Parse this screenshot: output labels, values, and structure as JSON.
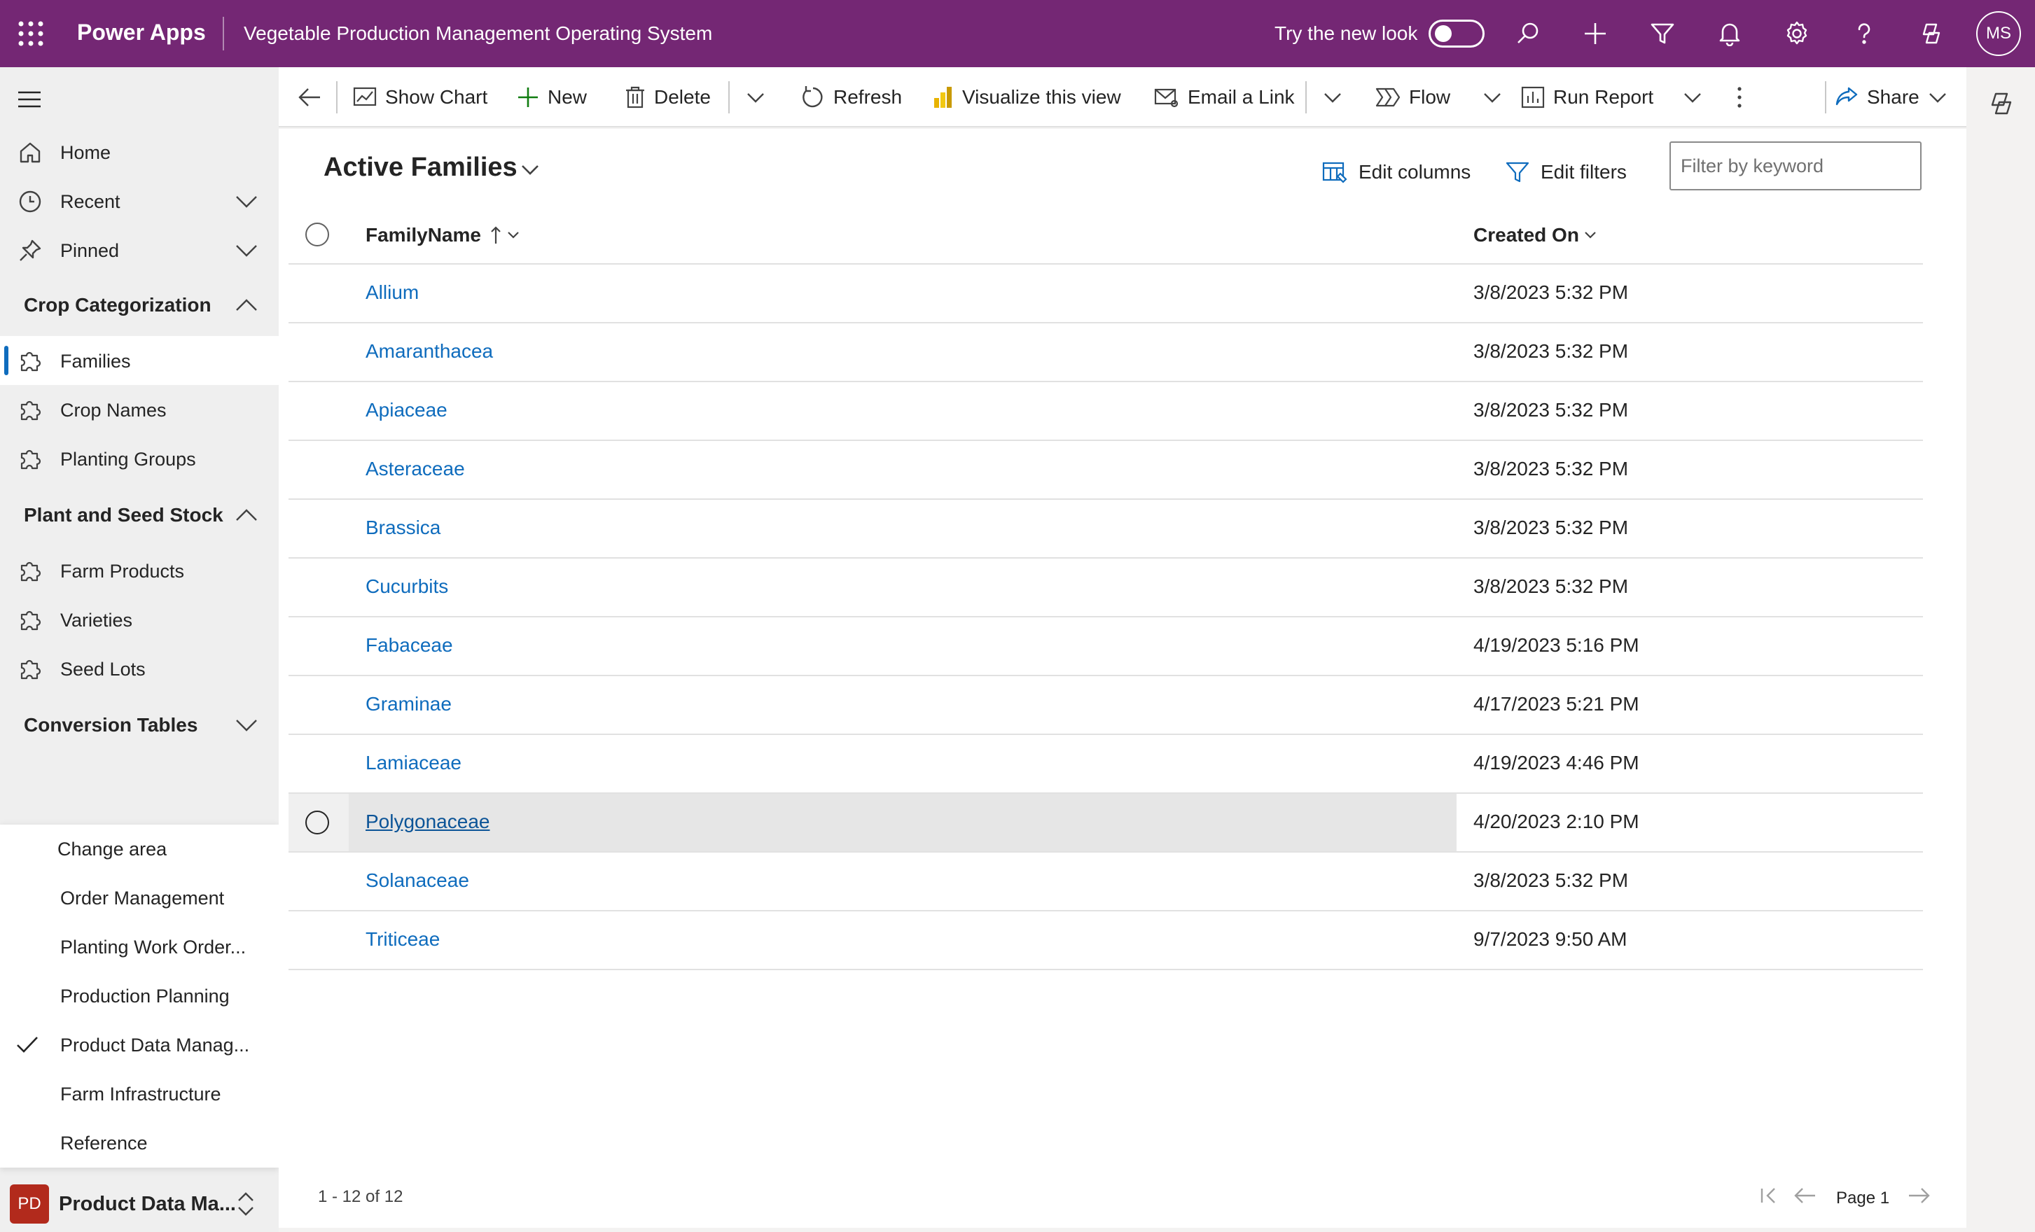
{
  "topbar": {
    "brand": "Power Apps",
    "app_title": "Vegetable Production Management Operating System",
    "try_new_look": "Try the new look",
    "avatar_initials": "MS"
  },
  "nav": {
    "home": "Home",
    "recent": "Recent",
    "pinned": "Pinned",
    "group_crop": "Crop Categorization",
    "families": "Families",
    "crop_names": "Crop Names",
    "planting_groups": "Planting Groups",
    "group_stock": "Plant and Seed Stock",
    "farm_products": "Farm Products",
    "varieties": "Varieties",
    "seed_lots": "Seed Lots",
    "group_conversion": "Conversion Tables"
  },
  "change_area": {
    "heading": "Change area",
    "items": [
      "Order Management",
      "Planting Work Order...",
      "Production Planning",
      "Product Data Manag...",
      "Farm Infrastructure",
      "Reference"
    ],
    "current_badge": "PD",
    "current_label": "Product Data Ma..."
  },
  "commands": {
    "show_chart": "Show Chart",
    "new": "New",
    "delete": "Delete",
    "refresh": "Refresh",
    "visualize": "Visualize this view",
    "email_link": "Email a Link",
    "flow": "Flow",
    "run_report": "Run Report",
    "share": "Share"
  },
  "view": {
    "title": "Active Families",
    "edit_columns": "Edit columns",
    "edit_filters": "Edit filters",
    "filter_placeholder": "Filter by keyword"
  },
  "grid": {
    "col_name": "FamilyName",
    "col_created": "Created On",
    "rows": [
      {
        "name": "Allium",
        "created": "3/8/2023 5:32 PM"
      },
      {
        "name": "Amaranthacea",
        "created": "3/8/2023 5:32 PM"
      },
      {
        "name": "Apiaceae",
        "created": "3/8/2023 5:32 PM"
      },
      {
        "name": "Asteraceae",
        "created": "3/8/2023 5:32 PM"
      },
      {
        "name": "Brassica",
        "created": "3/8/2023 5:32 PM"
      },
      {
        "name": "Cucurbits",
        "created": "3/8/2023 5:32 PM"
      },
      {
        "name": "Fabaceae",
        "created": "4/19/2023 5:16 PM"
      },
      {
        "name": "Graminae",
        "created": "4/17/2023 5:21 PM"
      },
      {
        "name": "Lamiaceae",
        "created": "4/19/2023 4:46 PM"
      },
      {
        "name": "Polygonaceae",
        "created": "4/20/2023 2:10 PM"
      },
      {
        "name": "Solanaceae",
        "created": "3/8/2023 5:32 PM"
      },
      {
        "name": "Triticeae",
        "created": "9/7/2023 9:50 AM"
      }
    ],
    "footer_count": "1 - 12 of 12",
    "page_label": "Page 1"
  },
  "colors": {
    "header_bg": "#742774",
    "link": "#0f6cbd",
    "selected_bar": "#0f6cbd",
    "area_badge": "#b22a1c"
  }
}
